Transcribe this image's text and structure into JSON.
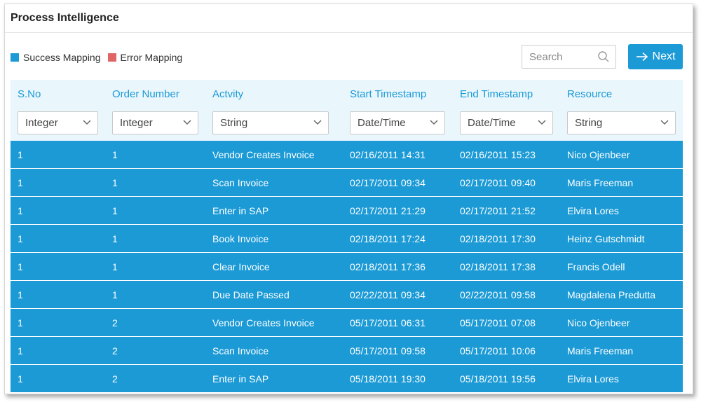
{
  "app": {
    "title": "Process Intelligence"
  },
  "legend": [
    {
      "label": "Success Mapping",
      "color": "#1b9ad6"
    },
    {
      "label": "Error Mapping",
      "color": "#e06666"
    }
  ],
  "search": {
    "placeholder": "Search"
  },
  "next_button": {
    "label": "Next"
  },
  "columns": [
    {
      "header": "S.No",
      "type": "Integer"
    },
    {
      "header": "Order Number",
      "type": "Integer"
    },
    {
      "header": "Actvity",
      "type": "String"
    },
    {
      "header": "Start Timestamp",
      "type": "Date/Time"
    },
    {
      "header": "End Timestamp",
      "type": "Date/Time"
    },
    {
      "header": "Resource",
      "type": "String"
    }
  ],
  "rows": [
    [
      "1",
      "1",
      "Vendor Creates Invoice",
      "02/16/2011 14:31",
      "02/16/2011 15:23",
      "Nico Ojenbeer"
    ],
    [
      "1",
      "1",
      "Scan Invoice",
      "02/17/2011 09:34",
      "02/17/2011 09:40",
      "Maris Freeman"
    ],
    [
      "1",
      "1",
      "Enter in SAP",
      "02/17/2011 21:29",
      "02/17/2011 21:52",
      "Elvira Lores"
    ],
    [
      "1",
      "1",
      "Book Invoice",
      "02/18/2011 17:24",
      "02/18/2011 17:30",
      "Heinz Gutschmidt"
    ],
    [
      "1",
      "1",
      "Clear Invoice",
      "02/18/2011 17:36",
      "02/18/2011 17:38",
      "Francis Odell"
    ],
    [
      "1",
      "1",
      "Due Date Passed",
      "02/22/2011 09:34",
      "02/22/2011 09:58",
      "Magdalena Predutta"
    ],
    [
      "1",
      "2",
      "Vendor Creates Invoice",
      "05/17/2011 06:31",
      "05/17/2011 07:08",
      "Nico Ojenbeer"
    ],
    [
      "1",
      "2",
      "Scan Invoice",
      "05/17/2011 09:58",
      "05/17/2011 10:06",
      "Maris Freeman"
    ],
    [
      "1",
      "2",
      "Enter in SAP",
      "05/18/2011 19:30",
      "05/18/2011 19:56",
      "Elvira Lores"
    ]
  ]
}
